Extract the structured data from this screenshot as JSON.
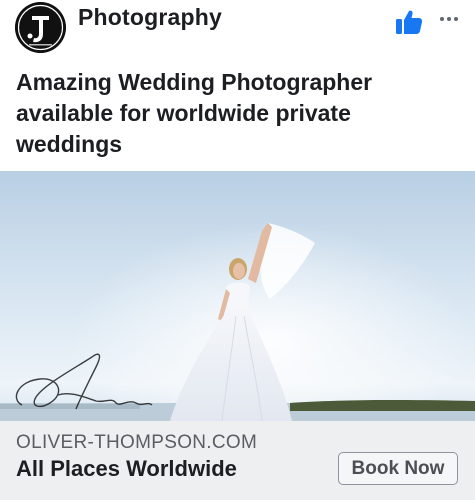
{
  "page": {
    "name": "Photography",
    "avatar_icon": "logo-avatar",
    "like_icon": "thumbs-up-icon",
    "menu_icon": "more-options-icon"
  },
  "post": {
    "text": "Amazing Wedding Photographer available for worldwide private weddings"
  },
  "photo": {
    "description_icon": "wedding-bride-photo",
    "watermark": "Oliver Thompson"
  },
  "link": {
    "domain": "OLIVER-THOMPSON.COM",
    "headline": "All Places Worldwide",
    "cta_label": "Book Now"
  },
  "colors": {
    "brand_blue": "#1877f2",
    "link_bar_bg": "#eeeff1"
  }
}
